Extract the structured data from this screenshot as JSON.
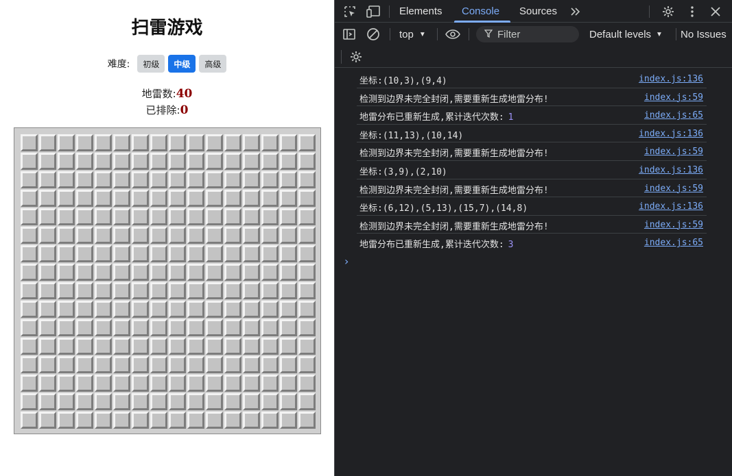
{
  "game": {
    "title": "扫雷游戏",
    "difficulty_label": "难度:",
    "difficulties": [
      {
        "label": "初级",
        "active": false
      },
      {
        "label": "中级",
        "active": true
      },
      {
        "label": "高级",
        "active": false
      }
    ],
    "mines_label": "地雷数:",
    "mines_value": "40",
    "cleared_label": "已排除:",
    "cleared_value": "0",
    "board": {
      "rows": 16,
      "cols": 16
    }
  },
  "devtools": {
    "tabs": [
      {
        "label": "Elements",
        "active": false
      },
      {
        "label": "Console",
        "active": true
      },
      {
        "label": "Sources",
        "active": false
      }
    ],
    "context": "top",
    "filter_placeholder": "Filter",
    "levels": "Default levels",
    "issues": "No Issues",
    "icons": [
      "inspect-icon",
      "device-toolbar-icon",
      "more-tabs-icon",
      "settings-icon",
      "kebab-menu-icon",
      "close-icon",
      "sidebar-icon",
      "clear-console-icon",
      "eye-icon",
      "filter-icon",
      "console-settings-icon"
    ],
    "colors": {
      "accent": "#7cacf8",
      "background": "#202124",
      "number": "#9e94f8"
    },
    "logs": [
      {
        "text": "坐标:(10,3),(9,4)",
        "source": "index.js:136"
      },
      {
        "text": "检测到边界未完全封闭,需要重新生成地雷分布!",
        "source": "index.js:59"
      },
      {
        "text": "地雷分布已重新生成,累计迭代次数:",
        "num": "1",
        "source": "index.js:65"
      },
      {
        "text": "坐标:(11,13),(10,14)",
        "source": "index.js:136"
      },
      {
        "text": "检测到边界未完全封闭,需要重新生成地雷分布!",
        "source": "index.js:59"
      },
      {
        "text": "坐标:(3,9),(2,10)",
        "source": "index.js:136"
      },
      {
        "text": "检测到边界未完全封闭,需要重新生成地雷分布!",
        "source": "index.js:59"
      },
      {
        "text": "坐标:(6,12),(5,13),(15,7),(14,8)",
        "source": "index.js:136"
      },
      {
        "text": "检测到边界未完全封闭,需要重新生成地雷分布!",
        "source": "index.js:59"
      },
      {
        "text": "地雷分布已重新生成,累计迭代次数:",
        "num": "3",
        "source": "index.js:65"
      }
    ]
  }
}
